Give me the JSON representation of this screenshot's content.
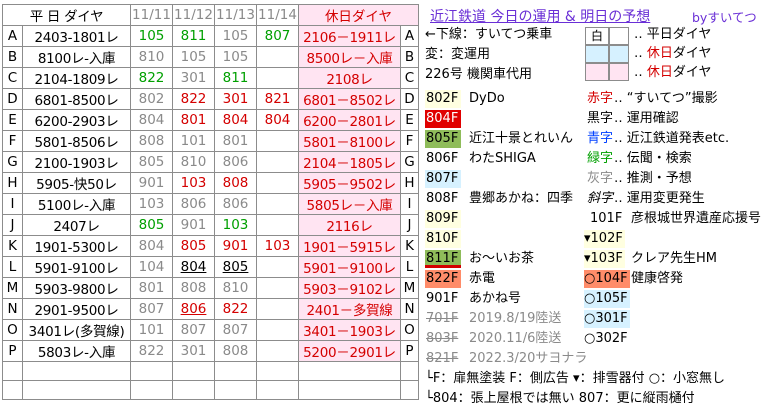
{
  "schedule": {
    "header": {
      "label": "平 日 ダイヤ",
      "days": [
        "11/11",
        "11/12",
        "11/13",
        "11/14"
      ],
      "holiday": "休日ダイヤ"
    },
    "rows": [
      {
        "l": "A",
        "main": "2403-1801レ",
        "d": [
          {
            "t": "105",
            "c": "green"
          },
          {
            "t": "811",
            "c": "green"
          },
          {
            "t": "105",
            "c": "gray"
          },
          {
            "t": "807",
            "c": "green"
          }
        ],
        "hol": "2106－1911レ"
      },
      {
        "l": "B",
        "main": "8100レ-入庫",
        "d": [
          {
            "t": "810",
            "c": "gray"
          },
          {
            "t": "105",
            "c": "gray"
          },
          {
            "t": "105",
            "c": "gray"
          },
          {
            "t": "",
            "c": "gray"
          }
        ],
        "hol": "8500レ－入庫"
      },
      {
        "l": "C",
        "main": "2104-1809レ",
        "d": [
          {
            "t": "822",
            "c": "green"
          },
          {
            "t": "301",
            "c": "gray"
          },
          {
            "t": "811",
            "c": "green"
          },
          {
            "t": "",
            "c": "gray"
          }
        ],
        "hol": "2108レ"
      },
      {
        "l": "D",
        "main": "6801-8500レ",
        "d": [
          {
            "t": "802",
            "c": "gray"
          },
          {
            "t": "822",
            "c": "red"
          },
          {
            "t": "301",
            "c": "red"
          },
          {
            "t": "821",
            "c": "red"
          }
        ],
        "hol": "6801－8502レ"
      },
      {
        "l": "E",
        "main": "6200-2903レ",
        "d": [
          {
            "t": "804",
            "c": "gray"
          },
          {
            "t": "801",
            "c": "red"
          },
          {
            "t": "804",
            "c": "red"
          },
          {
            "t": "804",
            "c": "red"
          }
        ],
        "hol": "6200－2801レ"
      },
      {
        "l": "F",
        "main": "5801-8506レ",
        "d": [
          {
            "t": "808",
            "c": "gray"
          },
          {
            "t": "101",
            "c": "gray"
          },
          {
            "t": "801",
            "c": "gray"
          },
          {
            "t": "",
            "c": "gray"
          }
        ],
        "hol": "5801－8100レ"
      },
      {
        "l": "G",
        "main": "2100-1903レ",
        "d": [
          {
            "t": "805",
            "c": "gray"
          },
          {
            "t": "810",
            "c": "gray"
          },
          {
            "t": "806",
            "c": "gray"
          },
          {
            "t": "",
            "c": "gray"
          }
        ],
        "hol": "2104－1805レ"
      },
      {
        "l": "H",
        "main": "5905-快50レ",
        "d": [
          {
            "t": "901",
            "c": "gray"
          },
          {
            "t": "103",
            "c": "red"
          },
          {
            "t": "808",
            "c": "red"
          },
          {
            "t": "",
            "c": "gray"
          }
        ],
        "hol": "5905－9502レ"
      },
      {
        "l": "I",
        "main": "5100レ-入庫",
        "d": [
          {
            "t": "103",
            "c": "gray"
          },
          {
            "t": "806",
            "c": "gray"
          },
          {
            "t": "806",
            "c": "gray"
          },
          {
            "t": "",
            "c": "gray"
          }
        ],
        "hol": "5805レ－入庫"
      },
      {
        "l": "J",
        "main": "2407レ",
        "d": [
          {
            "t": "805",
            "c": "green"
          },
          {
            "t": "901",
            "c": "gray"
          },
          {
            "t": "103",
            "c": "green"
          },
          {
            "t": "",
            "c": "gray"
          }
        ],
        "hol": "2116レ"
      },
      {
        "l": "K",
        "main": "1901-5300レ",
        "d": [
          {
            "t": "804",
            "c": "gray"
          },
          {
            "t": "805",
            "c": "red"
          },
          {
            "t": "901",
            "c": "red"
          },
          {
            "t": "103",
            "c": "red"
          }
        ],
        "hol": "1901－5915レ"
      },
      {
        "l": "L",
        "main": "5901-9100レ",
        "d": [
          {
            "t": "104",
            "c": "gray"
          },
          {
            "t": "804",
            "c": "black ul"
          },
          {
            "t": "805",
            "c": "black ul"
          },
          {
            "t": "",
            "c": "gray"
          }
        ],
        "hol": "5901－9100レ"
      },
      {
        "l": "M",
        "main": "5903-9800レ",
        "d": [
          {
            "t": "801",
            "c": "gray"
          },
          {
            "t": "808",
            "c": "gray"
          },
          {
            "t": "810",
            "c": "gray"
          },
          {
            "t": "",
            "c": "gray"
          }
        ],
        "hol": "5903－9102レ"
      },
      {
        "l": "N",
        "main": "2901-9500レ",
        "d": [
          {
            "t": "807",
            "c": "gray"
          },
          {
            "t": "806",
            "c": "red ul"
          },
          {
            "t": "822",
            "c": "red"
          },
          {
            "t": "",
            "c": "gray"
          }
        ],
        "hol": "2401－多賀線"
      },
      {
        "l": "O",
        "main": "3401レ(多賀線)",
        "d": [
          {
            "t": "101",
            "c": "gray"
          },
          {
            "t": "807",
            "c": "gray"
          },
          {
            "t": "807",
            "c": "gray"
          },
          {
            "t": "",
            "c": "gray"
          }
        ],
        "hol": "3401－1903レ"
      },
      {
        "l": "P",
        "main": "5803レ-入庫",
        "d": [
          {
            "t": "822",
            "c": "gray"
          },
          {
            "t": "301",
            "c": "gray"
          },
          {
            "t": "808",
            "c": "gray"
          },
          {
            "t": "",
            "c": "gray"
          }
        ],
        "hol": "5200－2901レ"
      }
    ]
  },
  "title": "近江鉄道 今日の運用 & 明日の予想",
  "byline": "byすいてつ",
  "legend_top": [
    {
      "text": "←下線：すいてつ乗車"
    },
    {
      "text": "変：変運用"
    },
    {
      "text": "226号 機関車代用"
    }
  ],
  "calendar_legend": {
    "col_weekday": "白",
    "row1": "‥ 平日ダイヤ",
    "row2": "‥ 休日ダイヤ",
    "row3": "‥ 休日ダイヤ",
    "hol_word": "休日"
  },
  "trains": [
    {
      "code": "802F",
      "name": "DyDo",
      "bg": "#ffffe0",
      "fg": "#000"
    },
    {
      "code": "804F",
      "name": "土山たぬき",
      "bg": "#e00000",
      "fg": "#fff"
    },
    {
      "code": "805F",
      "name": "近江十景とれいん",
      "bg": "#8fbc5a",
      "fg": "#000"
    },
    {
      "code": "806F",
      "name": "わたSHIGA",
      "bg": "#ffffff",
      "fg": "#000"
    },
    {
      "code": "807F",
      "name": "",
      "bg": "#d6f1ff",
      "fg": "#000"
    },
    {
      "code": "808F",
      "name": "豊郷あかね：四季",
      "bg": "#ffffff",
      "fg": "#000"
    },
    {
      "code": "809F",
      "name": "",
      "bg": "#ffffe0",
      "fg": "#000"
    },
    {
      "code": "810F",
      "name": "",
      "bg": "#ffffe0",
      "fg": "#000"
    },
    {
      "code": "811F",
      "name": "お～いお茶",
      "bg": "#8fbc5a",
      "fg": "#000"
    },
    {
      "code": "822F",
      "name": "赤電",
      "bg": "#ff8c69",
      "fg": "#000"
    },
    {
      "code": "901F",
      "name": "あかね号",
      "bg": "#ffffff",
      "fg": "#000"
    },
    {
      "code": "701F",
      "name": "2019.8/19陸送",
      "bg": "#ffffff",
      "fg": "#8a8a8a"
    },
    {
      "code": "803F",
      "name": "2020.11/6陸送",
      "bg": "#ffffff",
      "fg": "#8a8a8a"
    },
    {
      "code": "821F",
      "name": "2022.3/20サヨナラ",
      "bg": "#ffffff",
      "fg": "#8a8a8a"
    }
  ],
  "color_legend": [
    {
      "k": "赤字",
      "t": "‥ “すいてつ”撮影",
      "c": "#d40000"
    },
    {
      "k": "黒字",
      "t": "‥ 運用確認",
      "c": "#000"
    },
    {
      "k": "青字",
      "t": "‥ 近江鉄道発表etc.",
      "c": "#0040ff"
    },
    {
      "k": "緑字",
      "t": "‥ 伝聞・検索",
      "c": "#00a000"
    },
    {
      "k": "灰字",
      "t": "‥ 推測・予想",
      "c": "#8a8a8a"
    },
    {
      "k": "斜字",
      "t": "‥ 運用変更発生",
      "c": "#000"
    }
  ],
  "small_trains": [
    {
      "code": "101F",
      "name": "彦根城世界遺産応援号",
      "bg": "#fff"
    },
    {
      "code": "▾102F",
      "name": "",
      "bg": "#ffffe0"
    },
    {
      "code": "▾103F",
      "name": "クレア先生HM",
      "bg": "#ffffe0"
    },
    {
      "code": "○104F",
      "name": "健康啓発",
      "bg": "#ff8c69"
    },
    {
      "code": "○105F",
      "name": "",
      "bg": "#d6f1ff"
    },
    {
      "code": "○301F",
      "name": "",
      "bg": "#d6f1ff"
    },
    {
      "code": "○302F",
      "name": "",
      "bg": "#fff"
    }
  ],
  "footnote1": "└F：扉無塗装  F：側広告  ▾：排雪器付  ○：小窓無し",
  "footnote2": "└804：張上屋根では無い  807：更に縦雨樋付",
  "colors": {
    "red": "#d40000",
    "green": "#00a000",
    "gray": "#8a8a8a",
    "purple": "#6a2fd6",
    "pink": "#ffe4f2"
  }
}
